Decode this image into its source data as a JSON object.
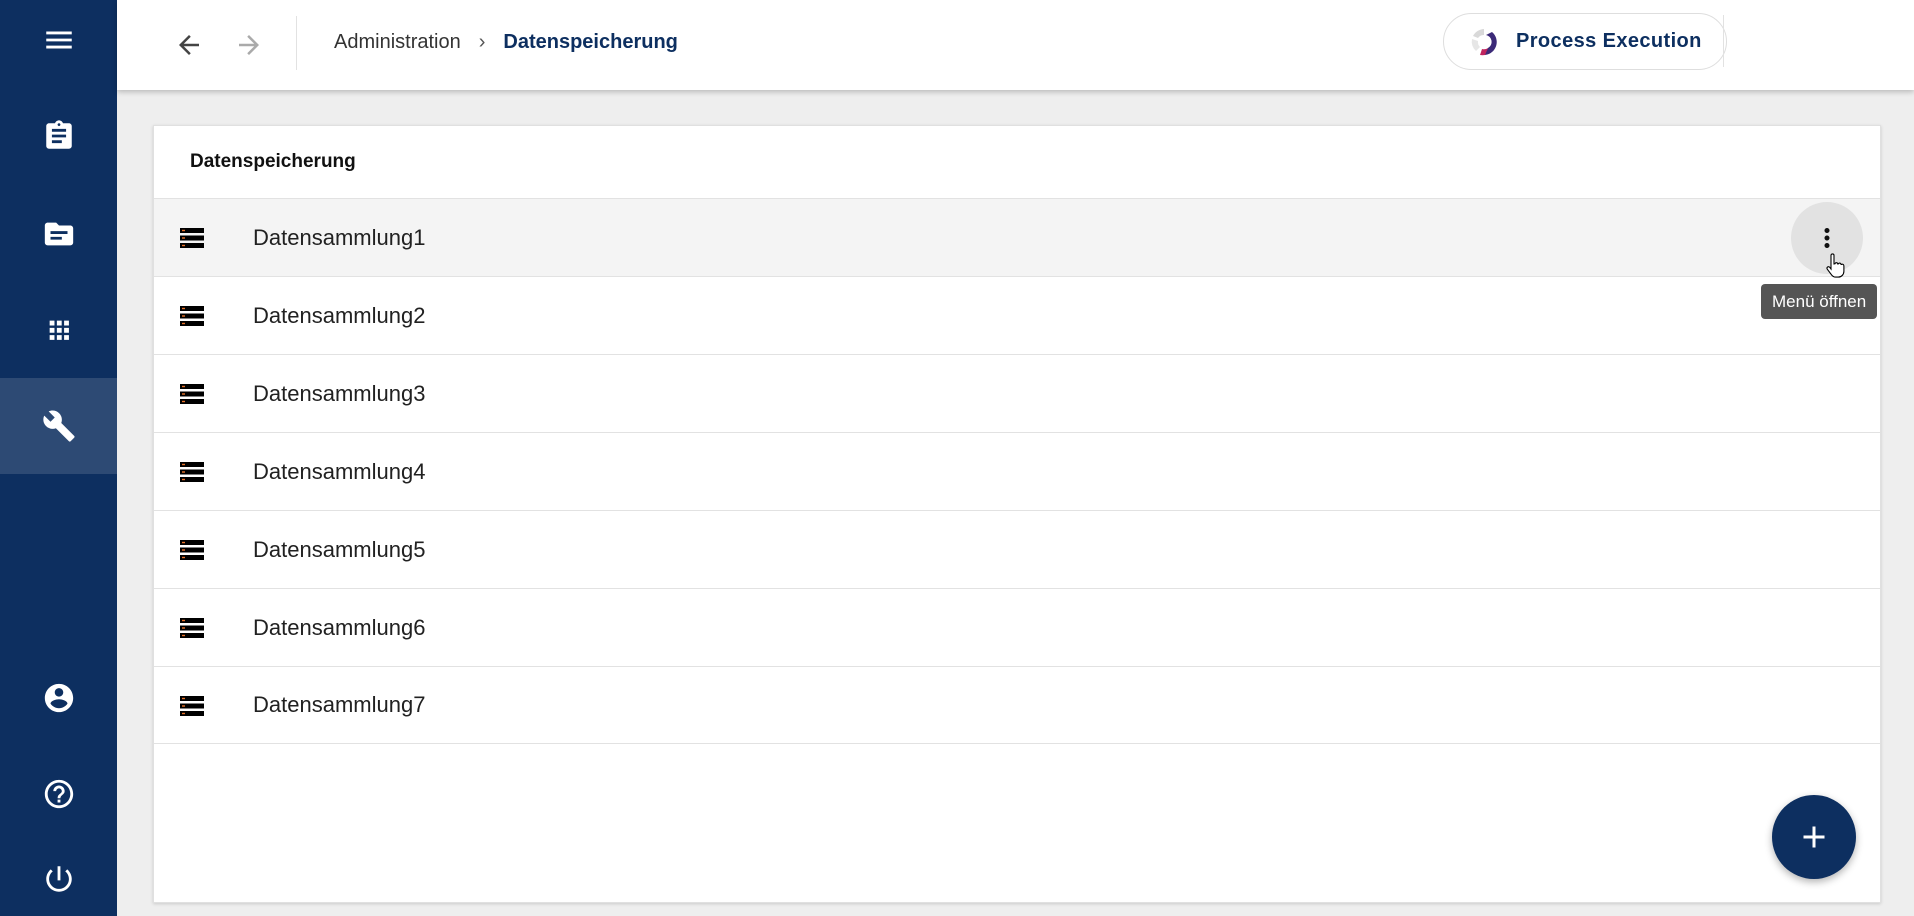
{
  "sidebar": {
    "top_items": [
      {
        "name": "menu",
        "icon": "hamburger-menu-icon"
      },
      {
        "name": "tasks",
        "icon": "clipboard-icon"
      },
      {
        "name": "documents",
        "icon": "document-folder-icon"
      },
      {
        "name": "apps",
        "icon": "app-grid-icon"
      },
      {
        "name": "administration",
        "icon": "wrench-icon",
        "active": true
      }
    ],
    "bottom_items": [
      {
        "name": "account",
        "icon": "account-circle-icon"
      },
      {
        "name": "help",
        "icon": "help-circle-icon"
      },
      {
        "name": "logout",
        "icon": "power-icon"
      }
    ],
    "background_color": "#0d2f60",
    "active_color": "#2d4a74"
  },
  "header": {
    "breadcrumb": {
      "parent": "Administration",
      "separator": "›",
      "current": "Datenspeicherung"
    },
    "process_execution_label": "Process Execution"
  },
  "card": {
    "title": "Datenspeicherung",
    "items": [
      {
        "label": "Datensammlung1"
      },
      {
        "label": "Datensammlung2"
      },
      {
        "label": "Datensammlung3"
      },
      {
        "label": "Datensammlung4"
      },
      {
        "label": "Datensammlung5"
      },
      {
        "label": "Datensammlung6"
      },
      {
        "label": "Datensammlung7"
      }
    ],
    "hovered_item": "Datensammlung1"
  },
  "tooltip": {
    "text": "Menü öffnen"
  },
  "colors": {
    "accent": "#0d2f60",
    "row_icon": "#000000",
    "row_icon_stripe": "#e8722a"
  }
}
